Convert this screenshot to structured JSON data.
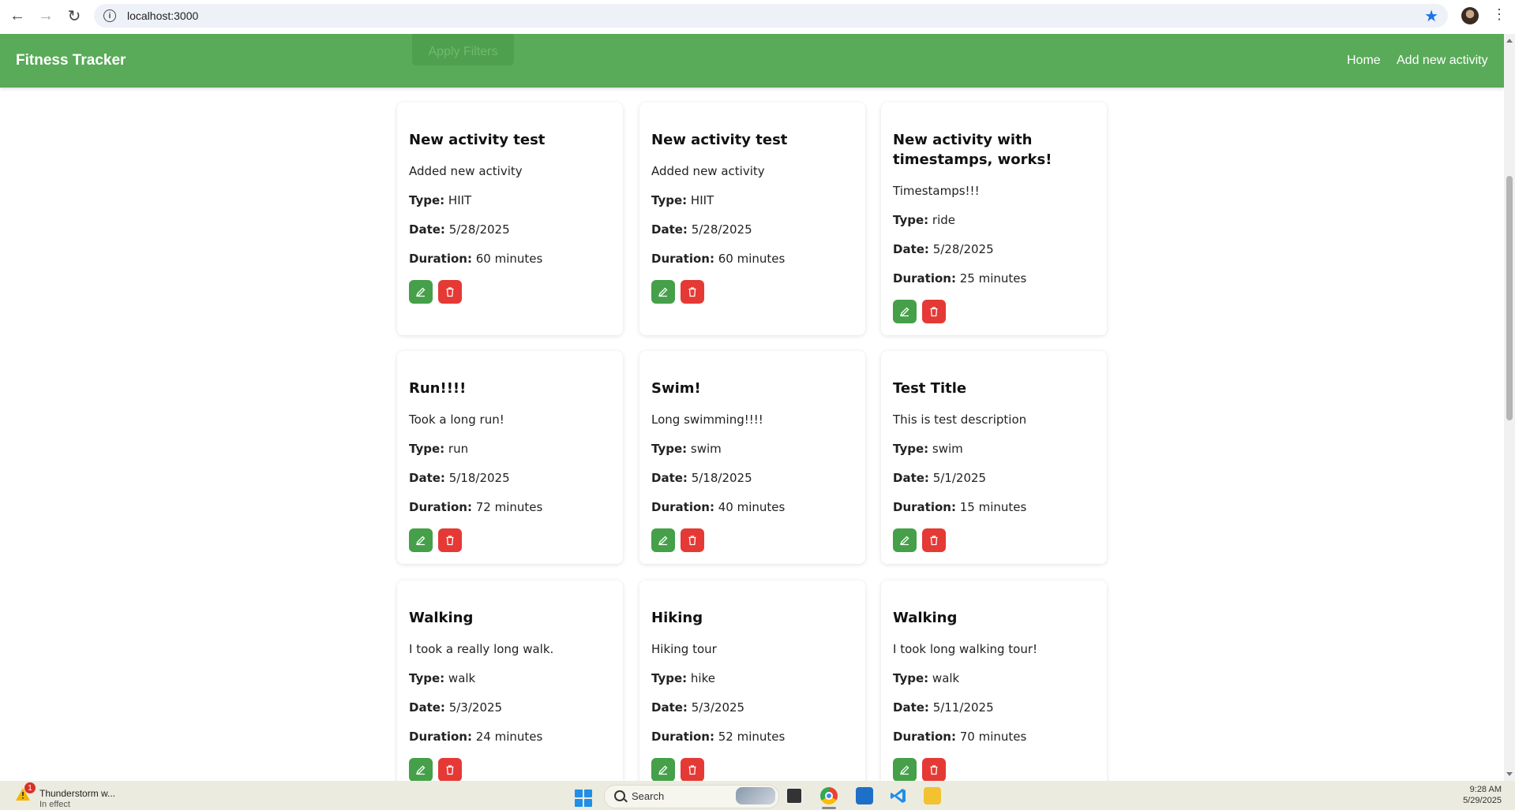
{
  "browser": {
    "url": "localhost:3000"
  },
  "header": {
    "app_title": "Fitness Tracker",
    "apply_filters_label": "Apply Filters",
    "nav": {
      "home": "Home",
      "add_activity": "Add new activity"
    },
    "color": "#59aa59"
  },
  "field_labels": {
    "type": "Type:",
    "date": "Date:",
    "duration": "Duration:"
  },
  "activities": [
    {
      "title": "New activity test",
      "description": "Added new activity",
      "type": "HIIT",
      "date": "5/28/2025",
      "duration": "60 minutes"
    },
    {
      "title": "New activity test",
      "description": "Added new activity",
      "type": "HIIT",
      "date": "5/28/2025",
      "duration": "60 minutes"
    },
    {
      "title": "New activity with timestamps, works!",
      "description": "Timestamps!!!",
      "type": "ride",
      "date": "5/28/2025",
      "duration": "25 minutes"
    },
    {
      "title": "Run!!!!",
      "description": "Took a long run!",
      "type": "run",
      "date": "5/18/2025",
      "duration": "72 minutes"
    },
    {
      "title": "Swim!",
      "description": "Long swimming!!!!",
      "type": "swim",
      "date": "5/18/2025",
      "duration": "40 minutes"
    },
    {
      "title": "Test Title",
      "description": "This is test description",
      "type": "swim",
      "date": "5/1/2025",
      "duration": "15 minutes"
    },
    {
      "title": "Walking",
      "description": "I took a really long walk.",
      "type": "walk",
      "date": "5/3/2025",
      "duration": "24 minutes"
    },
    {
      "title": "Hiking",
      "description": "Hiking tour",
      "type": "hike",
      "date": "5/3/2025",
      "duration": "52 minutes"
    },
    {
      "title": "Walking",
      "description": "I took long walking tour!",
      "type": "walk",
      "date": "5/11/2025",
      "duration": "70 minutes"
    }
  ],
  "buttons": {
    "edit_color": "#45a049",
    "delete_color": "#e53935",
    "edit_icon": "pencil-icon",
    "delete_icon": "trash-icon"
  },
  "taskbar": {
    "weather_title": "Thunderstorm w...",
    "weather_sub": "In effect",
    "weather_badge": "1",
    "search_label": "Search",
    "time": "9:28 AM",
    "date": "5/29/2025"
  }
}
